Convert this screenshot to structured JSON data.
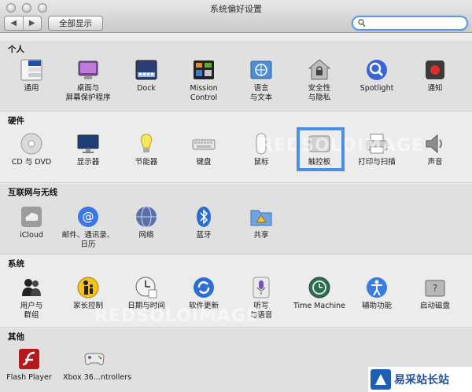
{
  "window": {
    "title": "系统偏好设置"
  },
  "toolbar": {
    "back": "◀",
    "forward": "▶",
    "show_all": "全部显示",
    "search_value": ""
  },
  "sections": [
    {
      "title": "个人",
      "items": [
        {
          "label": "通用",
          "icon": "file-menu-icon"
        },
        {
          "label": "桌面与\n屏幕保护程序",
          "icon": "desktop-icon"
        },
        {
          "label": "Dock",
          "icon": "dock-icon"
        },
        {
          "label": "Mission\nControl",
          "icon": "mission-control-icon"
        },
        {
          "label": "语言\n与文本",
          "icon": "un-flag-icon"
        },
        {
          "label": "安全性\n与隐私",
          "icon": "house-lock-icon"
        },
        {
          "label": "Spotlight",
          "icon": "magnifier-icon"
        },
        {
          "label": "通知",
          "icon": "notification-icon"
        }
      ]
    },
    {
      "title": "硬件",
      "items": [
        {
          "label": "CD 与 DVD",
          "icon": "disc-icon"
        },
        {
          "label": "显示器",
          "icon": "monitor-icon"
        },
        {
          "label": "节能器",
          "icon": "bulb-icon"
        },
        {
          "label": "键盘",
          "icon": "keyboard-icon"
        },
        {
          "label": "鼠标",
          "icon": "mouse-icon"
        },
        {
          "label": "触控板",
          "icon": "trackpad-icon"
        },
        {
          "label": "打印与扫描",
          "icon": "printer-icon"
        },
        {
          "label": "声音",
          "icon": "speaker-icon"
        }
      ]
    },
    {
      "title": "互联网与无线",
      "items": [
        {
          "label": "iCloud",
          "icon": "cloud-icon"
        },
        {
          "label": "邮件、通讯录、\n日历",
          "icon": "at-icon"
        },
        {
          "label": "网络",
          "icon": "globe-icon"
        },
        {
          "label": "蓝牙",
          "icon": "bluetooth-icon"
        },
        {
          "label": "共享",
          "icon": "sharing-folder-icon"
        }
      ]
    },
    {
      "title": "系统",
      "items": [
        {
          "label": "用户与\n群组",
          "icon": "users-icon"
        },
        {
          "label": "家长控制",
          "icon": "parental-icon"
        },
        {
          "label": "日期与时间",
          "icon": "clock-icon"
        },
        {
          "label": "软件更新",
          "icon": "update-icon"
        },
        {
          "label": "听写\n与语音",
          "icon": "microphone-icon"
        },
        {
          "label": "Time Machine",
          "icon": "time-machine-icon"
        },
        {
          "label": "辅助功能",
          "icon": "accessibility-icon"
        },
        {
          "label": "启动磁盘",
          "icon": "disk-icon"
        }
      ]
    },
    {
      "title": "其他",
      "items": [
        {
          "label": "Flash Player",
          "icon": "flash-icon"
        },
        {
          "label": "Xbox 36...ntrollers",
          "icon": "gamepad-icon"
        }
      ]
    }
  ],
  "watermarks": {
    "top": "REDSOLOIMAGE",
    "bottom": "REDSOLOIMAGE"
  },
  "brand": {
    "text": "易采站长站"
  }
}
